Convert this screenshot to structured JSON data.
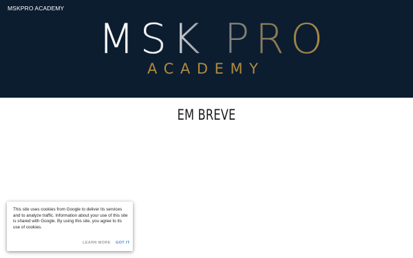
{
  "header": {
    "site_name": "MSKPRO ACADEMY",
    "logo": {
      "part1": "MSK",
      "part2": "PRO",
      "subtitle": "ACADEMY"
    }
  },
  "main": {
    "title": "EM BREVE"
  },
  "cookie_banner": {
    "message": "This site uses cookies from Google to deliver its services and to analyze traffic. Information about your use of this site is shared with Google. By using this site, you agree to its use of cookies.",
    "learn_more": "LEARN MORE",
    "got_it": "GOT IT"
  },
  "colors": {
    "header_bg": "#0c1d30",
    "gold": "#b08b3e",
    "link_blue": "#3f8ae0"
  }
}
